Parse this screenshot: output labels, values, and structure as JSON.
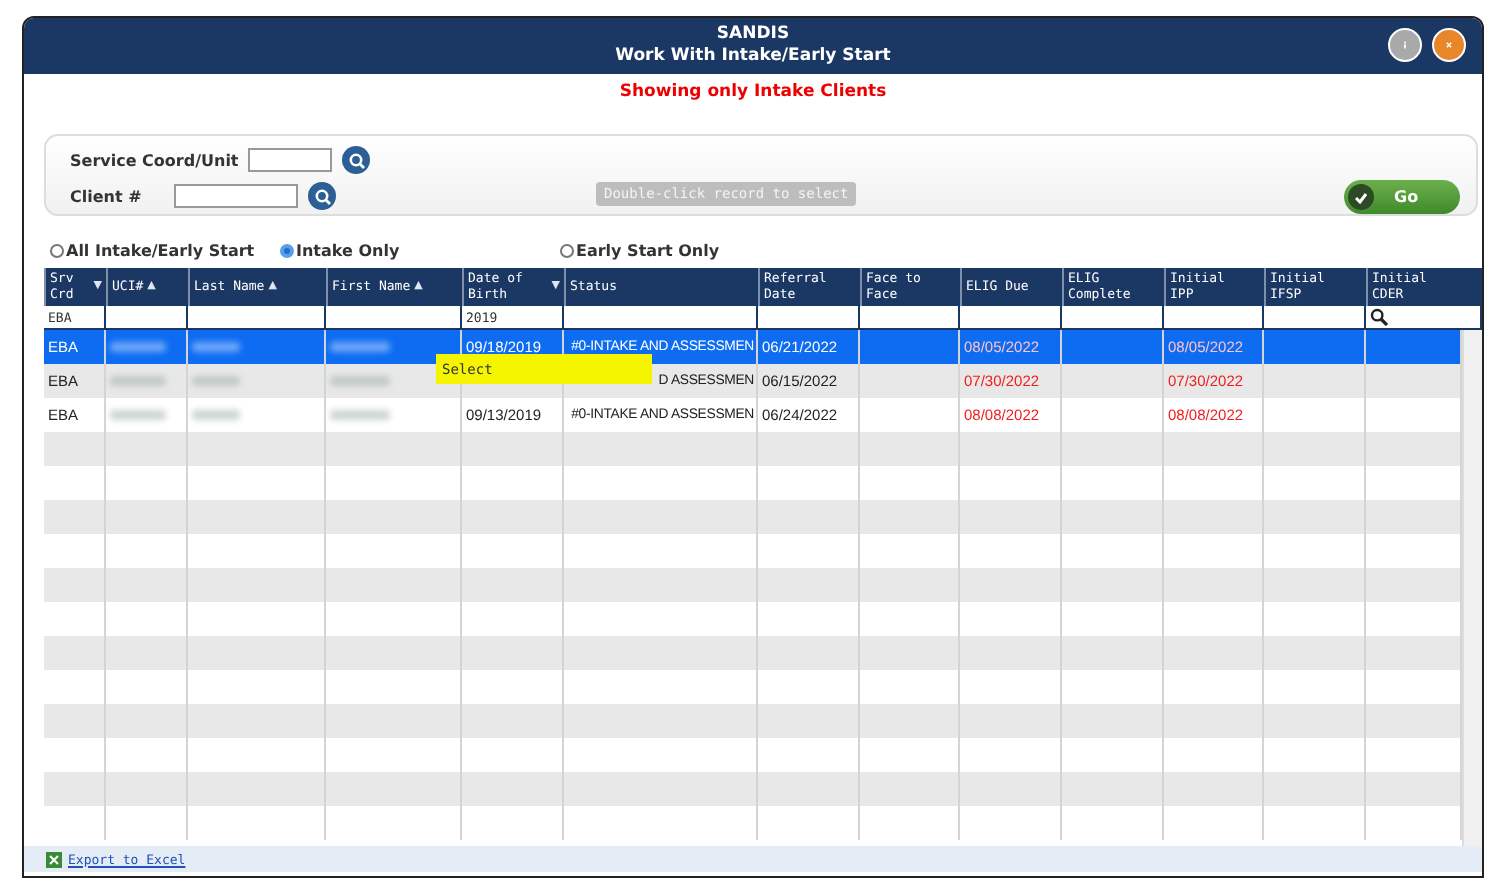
{
  "window": {
    "title": "SANDIS",
    "subtitle": "Work With Intake/Early Start"
  },
  "notice": "Showing only Intake Clients",
  "filters": {
    "service_coord_label": "Service Coord/Unit",
    "client_label": "Client #",
    "hint": "Double-click record to select",
    "go_button": "Go"
  },
  "radios": [
    {
      "label": "All Intake/Early Start",
      "selected": false
    },
    {
      "label": "Intake Only",
      "selected": true
    },
    {
      "label": "Early Start Only",
      "selected": false
    }
  ],
  "table": {
    "columns": [
      {
        "label": "Srv Crd",
        "sort": "▼",
        "filter": "EBA"
      },
      {
        "label": "UCI#",
        "sort": "▲"
      },
      {
        "label": "Last Name",
        "sort": "▲"
      },
      {
        "label": "First Name",
        "sort": "▲"
      },
      {
        "label": "Date of Birth",
        "sort": "▼",
        "filter": "2019"
      },
      {
        "label": "Status"
      },
      {
        "label": "Referral Date"
      },
      {
        "label": "Face to Face"
      },
      {
        "label": "ELIG Due",
        "alert": true
      },
      {
        "label": "ELIG Complete"
      },
      {
        "label": "Initial IPP",
        "alert": true
      },
      {
        "label": "Initial IFSP"
      },
      {
        "label": "Initial CDER",
        "search": true
      }
    ],
    "rows": [
      {
        "selected": true,
        "cells": [
          "EBA",
          "",
          "",
          "",
          "09/18/2019",
          "#0-INTAKE AND ASSESSMEN",
          "06/21/2022",
          "",
          "08/05/2022",
          "",
          "08/05/2022",
          "",
          ""
        ]
      },
      {
        "selected": false,
        "cells": [
          "EBA",
          "",
          "",
          "",
          "",
          "D ASSESSMEN",
          "06/15/2022",
          "",
          "07/30/2022",
          "",
          "07/30/2022",
          "",
          ""
        ]
      },
      {
        "selected": false,
        "cells": [
          "EBA",
          "",
          "",
          "",
          "09/13/2019",
          "#0-INTAKE AND ASSESSMEN",
          "06/24/2022",
          "",
          "08/08/2022",
          "",
          "08/08/2022",
          "",
          ""
        ]
      }
    ]
  },
  "tooltip": "Select",
  "footer": {
    "export_link": "Export to Excel"
  }
}
